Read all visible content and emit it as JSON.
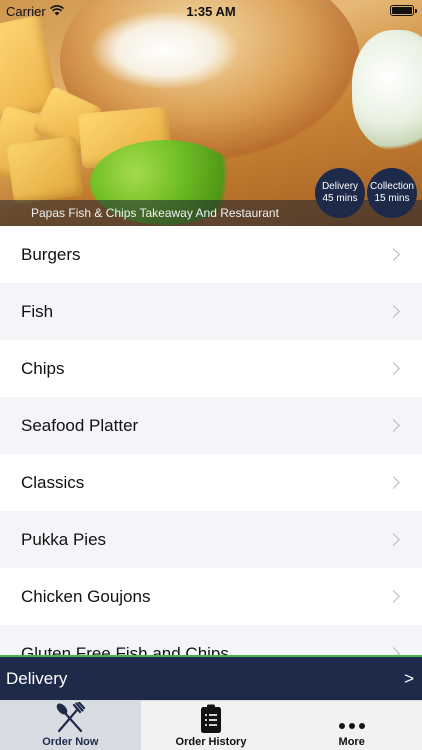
{
  "status_bar": {
    "carrier": "Carrier",
    "time": "1:35 AM"
  },
  "restaurant": {
    "name": "Papas Fish & Chips Takeaway And Restaurant"
  },
  "badges": {
    "delivery": {
      "title": "Delivery",
      "time": "45 mins"
    },
    "collection": {
      "title": "Collection",
      "time": "15 mins"
    }
  },
  "menu": {
    "items": [
      {
        "label": "Burgers"
      },
      {
        "label": "Fish"
      },
      {
        "label": "Chips"
      },
      {
        "label": "Seafood Platter"
      },
      {
        "label": "Classics"
      },
      {
        "label": "Pukka Pies"
      },
      {
        "label": "Chicken Goujons"
      },
      {
        "label": "Gluten Free Fish and Chips"
      }
    ]
  },
  "delivery_bar": {
    "label": "Delivery",
    "arrow": ">"
  },
  "tabs": [
    {
      "label": "Order Now",
      "icon": "fork-knife-icon",
      "active": true
    },
    {
      "label": "Order History",
      "icon": "clipboard-icon",
      "active": false
    },
    {
      "label": "More",
      "icon": "more-dots-icon",
      "active": false
    }
  ],
  "colors": {
    "navy": "#1e2a4a",
    "accent_green": "#4caf50"
  }
}
